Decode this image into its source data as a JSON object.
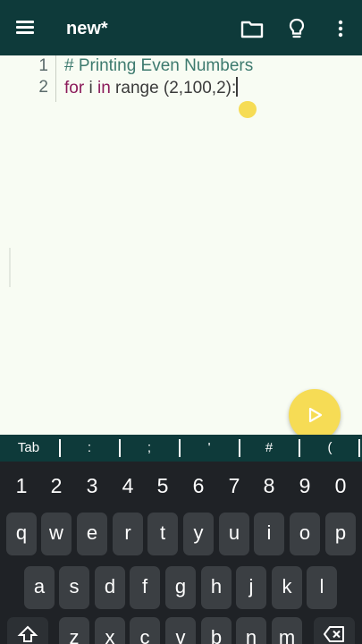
{
  "header": {
    "title": "new*",
    "icons": [
      "menu-icon",
      "folder-icon",
      "lightbulb-icon",
      "more-vert-icon"
    ]
  },
  "editor": {
    "lines": [
      {
        "number": "1",
        "tokens": [
          {
            "type": "comment",
            "text": "# Printing Even Numbers"
          }
        ]
      },
      {
        "number": "2",
        "tokens": [
          {
            "type": "keyword",
            "text": "for"
          },
          {
            "type": "plain",
            "text": " i "
          },
          {
            "type": "keyword",
            "text": "in"
          },
          {
            "type": "plain",
            "text": " range (2,100,2):"
          }
        ]
      }
    ],
    "colors": {
      "keyword": "#8b1a5a",
      "comment": "#3d7a6e",
      "plain": "#3b3b3b",
      "background": "#f8fcf3"
    }
  },
  "run_button": {
    "icon": "play-icon",
    "color": "#f6dc55"
  },
  "symbol_bar": {
    "keys": [
      "Tab",
      ":",
      ";",
      "'",
      "#",
      "("
    ]
  },
  "keyboard": {
    "numbers": [
      "1",
      "2",
      "3",
      "4",
      "5",
      "6",
      "7",
      "8",
      "9",
      "0"
    ],
    "row1": [
      "q",
      "w",
      "e",
      "r",
      "t",
      "y",
      "u",
      "i",
      "o",
      "p"
    ],
    "row2": [
      "a",
      "s",
      "d",
      "f",
      "g",
      "h",
      "j",
      "k",
      "l"
    ],
    "row3": [
      "z",
      "x",
      "c",
      "v",
      "b",
      "n",
      "m"
    ],
    "icons": [
      "shift-icon",
      "backspace-icon"
    ]
  },
  "theme": {
    "toolbar": "#0e3a3a",
    "keyboard": "#1f2226",
    "key": "#3b3f43"
  }
}
